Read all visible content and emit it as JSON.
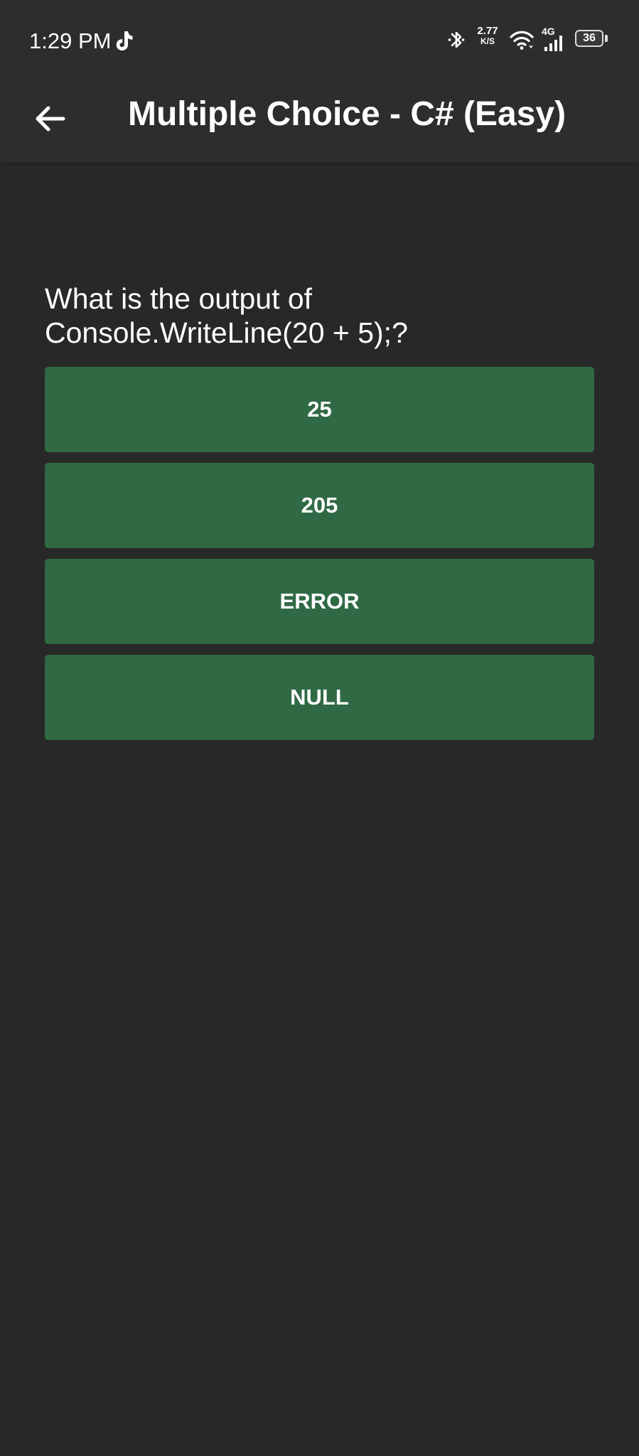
{
  "status_bar": {
    "time": "1:29 PM",
    "net_speed_value": "2.77",
    "net_speed_unit": "K/S",
    "network_label": "4G",
    "battery_level": "36",
    "icons": [
      "tiktok-icon",
      "bluetooth-icon",
      "wifi-icon",
      "signal-icon",
      "battery-icon"
    ]
  },
  "app_bar": {
    "title": "Multiple Choice - C# (Easy)",
    "back_icon": "arrow-left-icon"
  },
  "quiz": {
    "question": "What is the output of Console.WriteLine(20 + 5);?",
    "answers": [
      {
        "label": "25"
      },
      {
        "label": "205"
      },
      {
        "label": "ERROR"
      },
      {
        "label": "NULL"
      }
    ]
  },
  "colors": {
    "background": "#282828",
    "app_bar": "#2d2d2d",
    "answer_button": "#306a45",
    "text": "#ffffff"
  }
}
